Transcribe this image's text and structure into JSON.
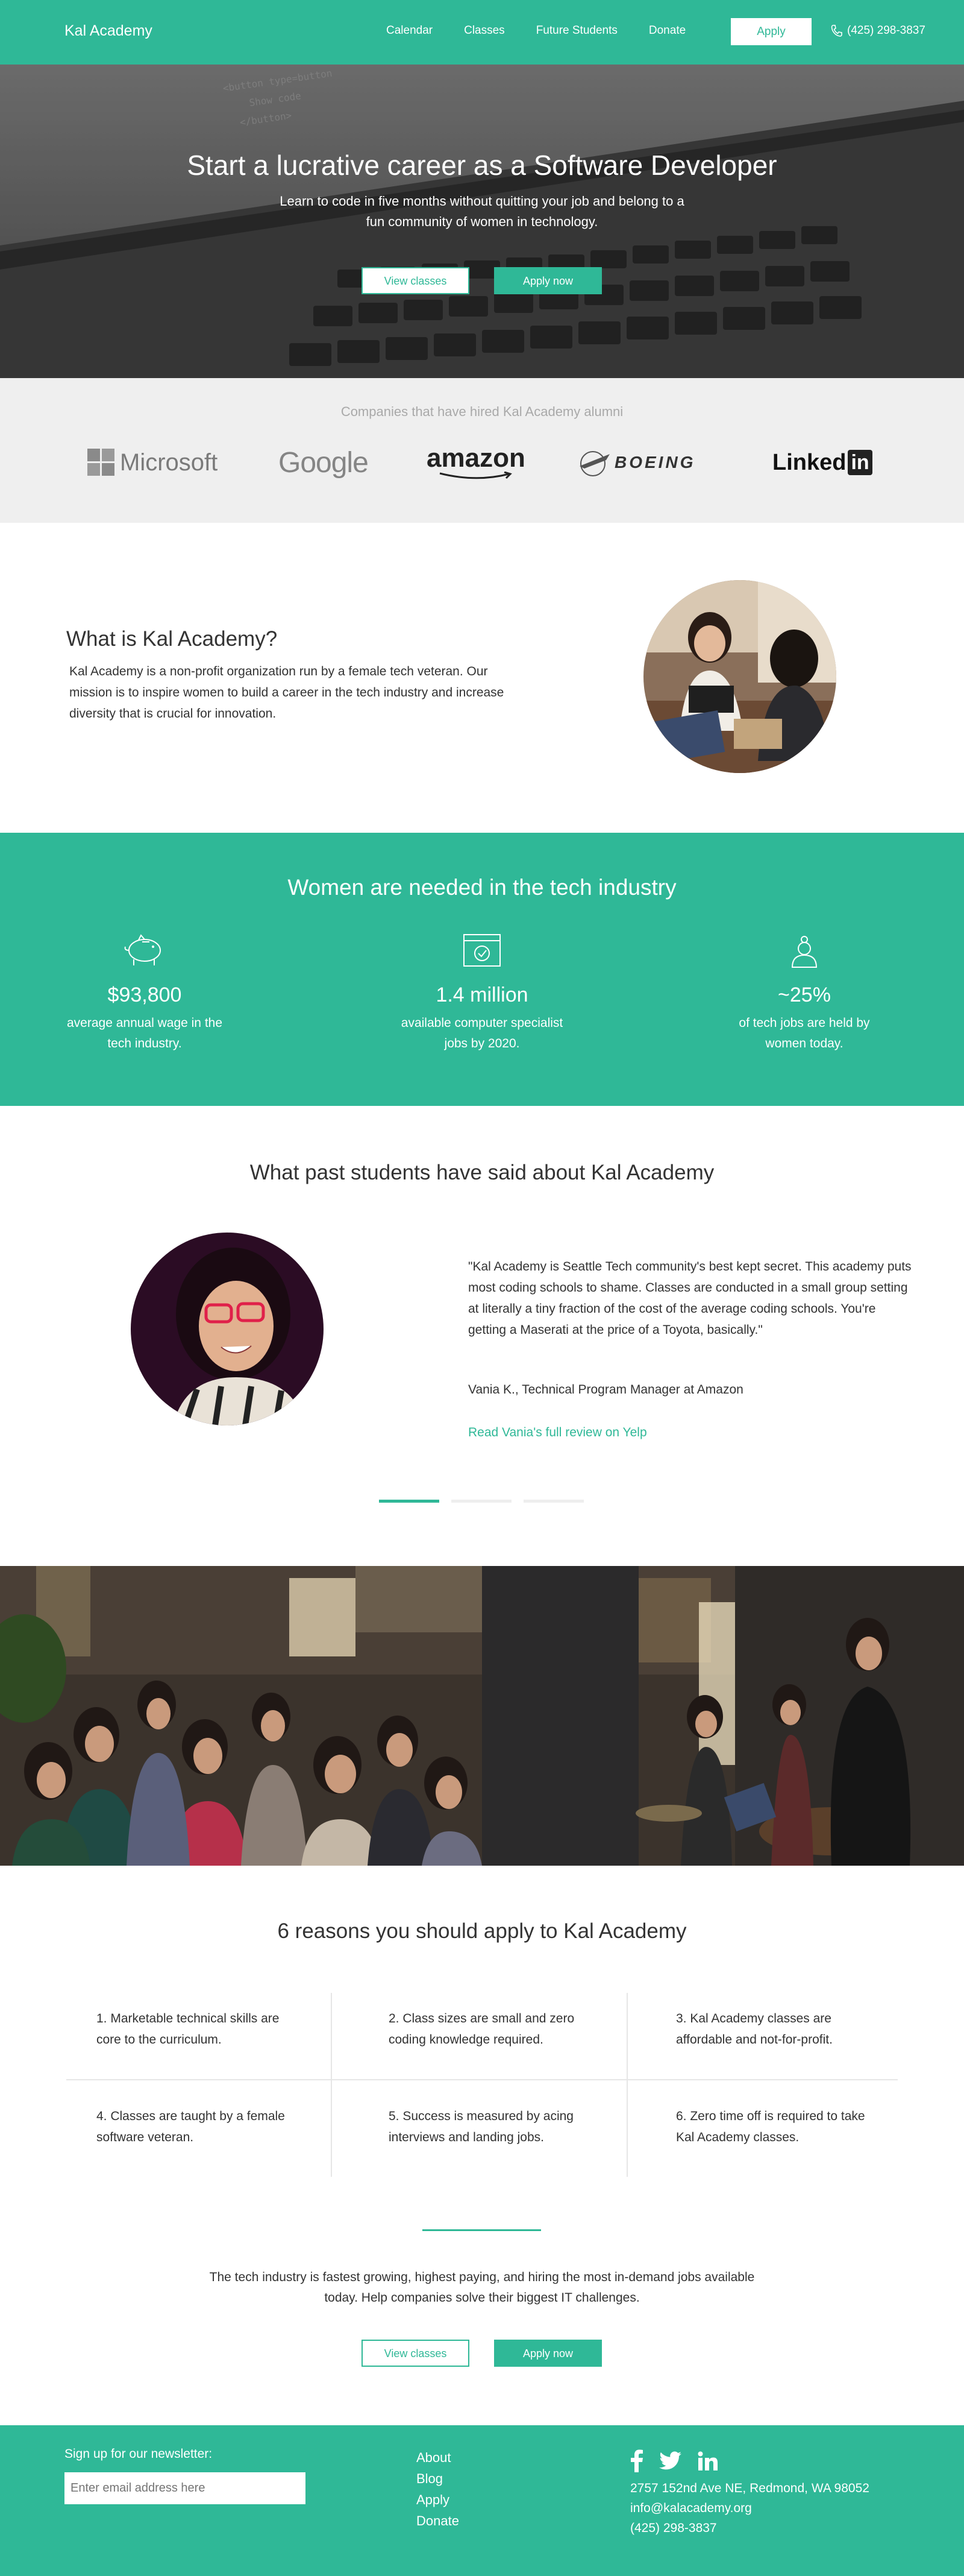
{
  "nav": {
    "brand": "Kal Academy",
    "links": [
      "Calendar",
      "Classes",
      "Future Students",
      "Donate"
    ],
    "apply": "Apply",
    "phone": "(425) 298-3837"
  },
  "hero": {
    "title": "Start a lucrative career as a Software Developer",
    "subtitle": "Learn to code in five months without quitting your job and belong to a fun community of women in technology.",
    "view_classes": "View classes",
    "apply_now": "Apply now",
    "code_lines": [
      "<button type=button",
      "Show code",
      "</button>"
    ]
  },
  "companies": {
    "title": "Companies that have hired Kal Academy alumni",
    "logos": [
      "Microsoft",
      "Google",
      "amazon",
      "BOEING",
      "Linked",
      "in"
    ]
  },
  "whatis": {
    "title": "What is Kal Academy?",
    "text": "Kal Academy is a non-profit organization run by a female tech veteran. Our mission is to inspire women to build a career in the tech industry and increase diversity that is crucial for innovation."
  },
  "stats": {
    "title": "Women are needed in the tech industry",
    "items": [
      {
        "icon": "piggy-bank-icon",
        "value": "$93,800",
        "desc": "average annual wage in the tech industry."
      },
      {
        "icon": "browser-check-icon",
        "value": "1.4 million",
        "desc": "available computer specialist jobs by 2020."
      },
      {
        "icon": "woman-icon",
        "value": "~25%",
        "desc": "of tech jobs are held by women today."
      }
    ]
  },
  "testimonials": {
    "title": "What past students have said about Kal Academy",
    "quote": "\"Kal Academy is Seattle Tech community's best kept secret. This academy puts most coding schools to shame. Classes are conducted in a small group setting at literally a tiny fraction of the cost of the average coding schools. You're getting a Maserati at the price of a Toyota, basically.\"",
    "author": "Vania K., Technical Program Manager at Amazon",
    "link": "Read Vania's full review on Yelp",
    "active_slide": 1,
    "slide_count": 3
  },
  "reasons": {
    "title": "6 reasons you should apply to Kal Academy",
    "items": [
      "1. Marketable technical skills are core to the curriculum.",
      "2. Class sizes are small and zero coding knowledge required.",
      "3. Kal Academy classes are affordable and not-for-profit.",
      "4. Classes are taught by a female software veteran.",
      "5. Success is measured by acing interviews and landing jobs.",
      "6. Zero time off is required to take Kal Academy classes."
    ]
  },
  "cta": {
    "text": "The tech industry is fastest growing, highest paying, and hiring the most in-demand jobs available today. Help companies solve their biggest IT challenges.",
    "view_classes": "View classes",
    "apply_now": "Apply now"
  },
  "footer": {
    "newsletter_label": "Sign up for our newsletter:",
    "newsletter_placeholder": "Enter email address here",
    "links": [
      "About",
      "Blog",
      "Apply",
      "Donate"
    ],
    "social": [
      "facebook-icon",
      "twitter-icon",
      "linkedin-icon"
    ],
    "address": "2757 152nd Ave NE, Redmond, WA 98052",
    "email": "info@kalacademy.org",
    "phone": "(425) 298-3837"
  },
  "colors": {
    "accent": "#2fb897",
    "light_gray": "#efefef"
  }
}
